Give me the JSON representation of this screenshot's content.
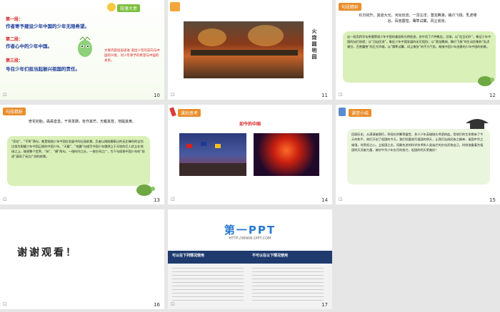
{
  "slides": [
    {
      "num": "10",
      "badge": "段落大意",
      "parts": [
        {
          "title": "第一段：",
          "text": "作者寄予建设少年中国的少年无限希望。"
        },
        {
          "title": "第二段：",
          "text": "作者心中的少年中国。"
        },
        {
          "title": "第三段：",
          "text": "号召少年们担当起振兴祖国的责任。"
        }
      ],
      "note": "文章内容层层递进 道出少年的志向与中国的兴衰，对少年寄予的希望与中国的关系。"
    },
    {
      "num": "11",
      "vertical_title": "火烧圆明园"
    },
    {
      "num": "12",
      "badge": "句段精析",
      "poem": "红日初升，其道大光。河出伏流，一泻汪洋。潜龙腾渊，鳞爪飞扬。乳虎啸谷，百兽震惶。鹰隼试翼，风尘翕张。",
      "analysis": "这一段用四字句热情赞颂少年中国的美丽和光明前途。其中用了六种象征。比喻，以“红日初升”，象征少年中国的灿烂前程；以“河出伏流”，象征少年中国发展的无可阻挡；以“潜龙腾渊，鳞爪飞扬”的生动形象和“乳虎啸谷，百兽震惶”的巨大声威，以“鹰隼试翼，风尘翕张”的不凡气势，喻指中国少年创建的少年中国的前景。"
    },
    {
      "num": "13",
      "badge": "句段精析",
      "poem": "奇花初胎，矞矞皇皇。干将发硎，有作其芒。天戴其苍，地履其黄。",
      "analysis": "“奇花”、“干将”两句，都是喻指少年中国在发展中的壮丽前景。后者以刚刚磨砺过的无比锋利的宝剑比拟为刚健少年中国正焕的中国少年。“天戴”、“地履”句描写中国少年傲然立于天地的巨人状立在地球之上，雄视整个世界。“纵”、“横”两句，一指时间之长，一指空间之广，为下句颂扬中国少年的“前途”展现了无比广阔的前景。"
    },
    {
      "num": "14",
      "badge": "课后思考",
      "heading": "如今的中国"
    },
    {
      "num": "15",
      "badge": "课堂小结",
      "summary": "回顾历史，从满清被腐朽，到现在的繁荣盛世，多少少年英雄抛头颅洒热血，用他们的生命换来了今天的和平，他们开创了祖国的今天，我们则要谱写祖国的明天，让我们弘扬民族之精神，振国中华之雄强，时责担之心，立振国之志，用最先进的科学技术和人类灿烂的文化武装自己，时刻准备着为祖国明天贡献力量，做好中华少年应尽的努力，祖国的明天更美好！"
    },
    {
      "num": "16",
      "thanks": "谢谢观看！"
    },
    {
      "num": "17",
      "logo": "第一PPT",
      "url": "HTTP://WWW.1PPT.COM",
      "left_title": "可以在下列情况使用",
      "right_title": "不可以在以下情况使用"
    }
  ]
}
